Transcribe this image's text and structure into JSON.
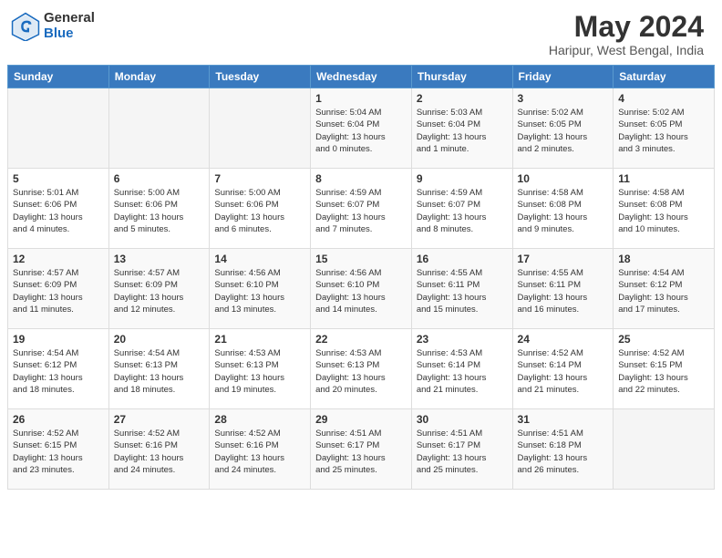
{
  "header": {
    "logo_general": "General",
    "logo_blue": "Blue",
    "title": "May 2024",
    "subtitle": "Haripur, West Bengal, India"
  },
  "days_of_week": [
    "Sunday",
    "Monday",
    "Tuesday",
    "Wednesday",
    "Thursday",
    "Friday",
    "Saturday"
  ],
  "weeks": [
    [
      {
        "num": "",
        "info": ""
      },
      {
        "num": "",
        "info": ""
      },
      {
        "num": "",
        "info": ""
      },
      {
        "num": "1",
        "info": "Sunrise: 5:04 AM\nSunset: 6:04 PM\nDaylight: 13 hours\nand 0 minutes."
      },
      {
        "num": "2",
        "info": "Sunrise: 5:03 AM\nSunset: 6:04 PM\nDaylight: 13 hours\nand 1 minute."
      },
      {
        "num": "3",
        "info": "Sunrise: 5:02 AM\nSunset: 6:05 PM\nDaylight: 13 hours\nand 2 minutes."
      },
      {
        "num": "4",
        "info": "Sunrise: 5:02 AM\nSunset: 6:05 PM\nDaylight: 13 hours\nand 3 minutes."
      }
    ],
    [
      {
        "num": "5",
        "info": "Sunrise: 5:01 AM\nSunset: 6:06 PM\nDaylight: 13 hours\nand 4 minutes."
      },
      {
        "num": "6",
        "info": "Sunrise: 5:00 AM\nSunset: 6:06 PM\nDaylight: 13 hours\nand 5 minutes."
      },
      {
        "num": "7",
        "info": "Sunrise: 5:00 AM\nSunset: 6:06 PM\nDaylight: 13 hours\nand 6 minutes."
      },
      {
        "num": "8",
        "info": "Sunrise: 4:59 AM\nSunset: 6:07 PM\nDaylight: 13 hours\nand 7 minutes."
      },
      {
        "num": "9",
        "info": "Sunrise: 4:59 AM\nSunset: 6:07 PM\nDaylight: 13 hours\nand 8 minutes."
      },
      {
        "num": "10",
        "info": "Sunrise: 4:58 AM\nSunset: 6:08 PM\nDaylight: 13 hours\nand 9 minutes."
      },
      {
        "num": "11",
        "info": "Sunrise: 4:58 AM\nSunset: 6:08 PM\nDaylight: 13 hours\nand 10 minutes."
      }
    ],
    [
      {
        "num": "12",
        "info": "Sunrise: 4:57 AM\nSunset: 6:09 PM\nDaylight: 13 hours\nand 11 minutes."
      },
      {
        "num": "13",
        "info": "Sunrise: 4:57 AM\nSunset: 6:09 PM\nDaylight: 13 hours\nand 12 minutes."
      },
      {
        "num": "14",
        "info": "Sunrise: 4:56 AM\nSunset: 6:10 PM\nDaylight: 13 hours\nand 13 minutes."
      },
      {
        "num": "15",
        "info": "Sunrise: 4:56 AM\nSunset: 6:10 PM\nDaylight: 13 hours\nand 14 minutes."
      },
      {
        "num": "16",
        "info": "Sunrise: 4:55 AM\nSunset: 6:11 PM\nDaylight: 13 hours\nand 15 minutes."
      },
      {
        "num": "17",
        "info": "Sunrise: 4:55 AM\nSunset: 6:11 PM\nDaylight: 13 hours\nand 16 minutes."
      },
      {
        "num": "18",
        "info": "Sunrise: 4:54 AM\nSunset: 6:12 PM\nDaylight: 13 hours\nand 17 minutes."
      }
    ],
    [
      {
        "num": "19",
        "info": "Sunrise: 4:54 AM\nSunset: 6:12 PM\nDaylight: 13 hours\nand 18 minutes."
      },
      {
        "num": "20",
        "info": "Sunrise: 4:54 AM\nSunset: 6:13 PM\nDaylight: 13 hours\nand 18 minutes."
      },
      {
        "num": "21",
        "info": "Sunrise: 4:53 AM\nSunset: 6:13 PM\nDaylight: 13 hours\nand 19 minutes."
      },
      {
        "num": "22",
        "info": "Sunrise: 4:53 AM\nSunset: 6:13 PM\nDaylight: 13 hours\nand 20 minutes."
      },
      {
        "num": "23",
        "info": "Sunrise: 4:53 AM\nSunset: 6:14 PM\nDaylight: 13 hours\nand 21 minutes."
      },
      {
        "num": "24",
        "info": "Sunrise: 4:52 AM\nSunset: 6:14 PM\nDaylight: 13 hours\nand 21 minutes."
      },
      {
        "num": "25",
        "info": "Sunrise: 4:52 AM\nSunset: 6:15 PM\nDaylight: 13 hours\nand 22 minutes."
      }
    ],
    [
      {
        "num": "26",
        "info": "Sunrise: 4:52 AM\nSunset: 6:15 PM\nDaylight: 13 hours\nand 23 minutes."
      },
      {
        "num": "27",
        "info": "Sunrise: 4:52 AM\nSunset: 6:16 PM\nDaylight: 13 hours\nand 24 minutes."
      },
      {
        "num": "28",
        "info": "Sunrise: 4:52 AM\nSunset: 6:16 PM\nDaylight: 13 hours\nand 24 minutes."
      },
      {
        "num": "29",
        "info": "Sunrise: 4:51 AM\nSunset: 6:17 PM\nDaylight: 13 hours\nand 25 minutes."
      },
      {
        "num": "30",
        "info": "Sunrise: 4:51 AM\nSunset: 6:17 PM\nDaylight: 13 hours\nand 25 minutes."
      },
      {
        "num": "31",
        "info": "Sunrise: 4:51 AM\nSunset: 6:18 PM\nDaylight: 13 hours\nand 26 minutes."
      },
      {
        "num": "",
        "info": ""
      }
    ]
  ]
}
